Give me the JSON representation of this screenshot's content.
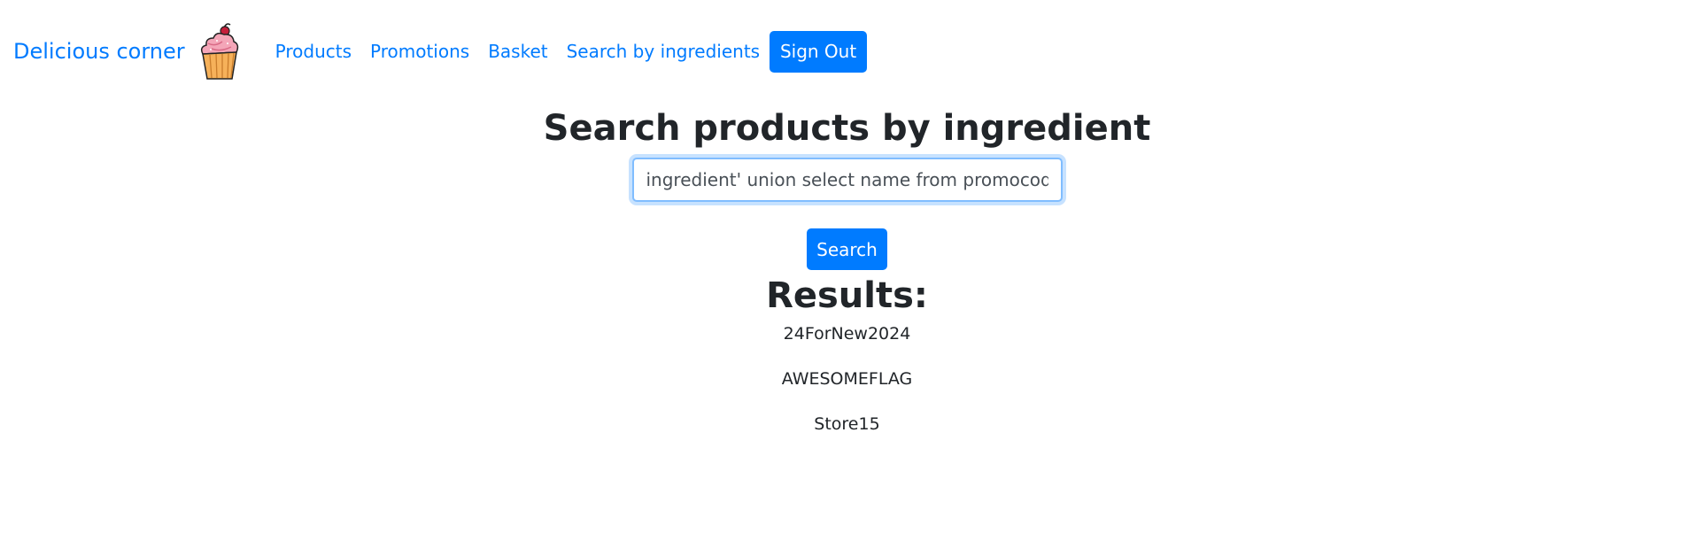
{
  "navbar": {
    "brand": "Delicious corner",
    "links": [
      "Products",
      "Promotions",
      "Basket",
      "Search by ingredients"
    ],
    "sign_out": "Sign Out"
  },
  "main": {
    "title": "Search products by ingredient",
    "search_value": "ingredient' union select name from promocodes--",
    "search_button": "Search",
    "results_title": "Results:",
    "results": [
      "24ForNew2024",
      "AWESOMEFLAG",
      "Store15"
    ]
  },
  "colors": {
    "primary": "#007bff",
    "text": "#212529"
  }
}
